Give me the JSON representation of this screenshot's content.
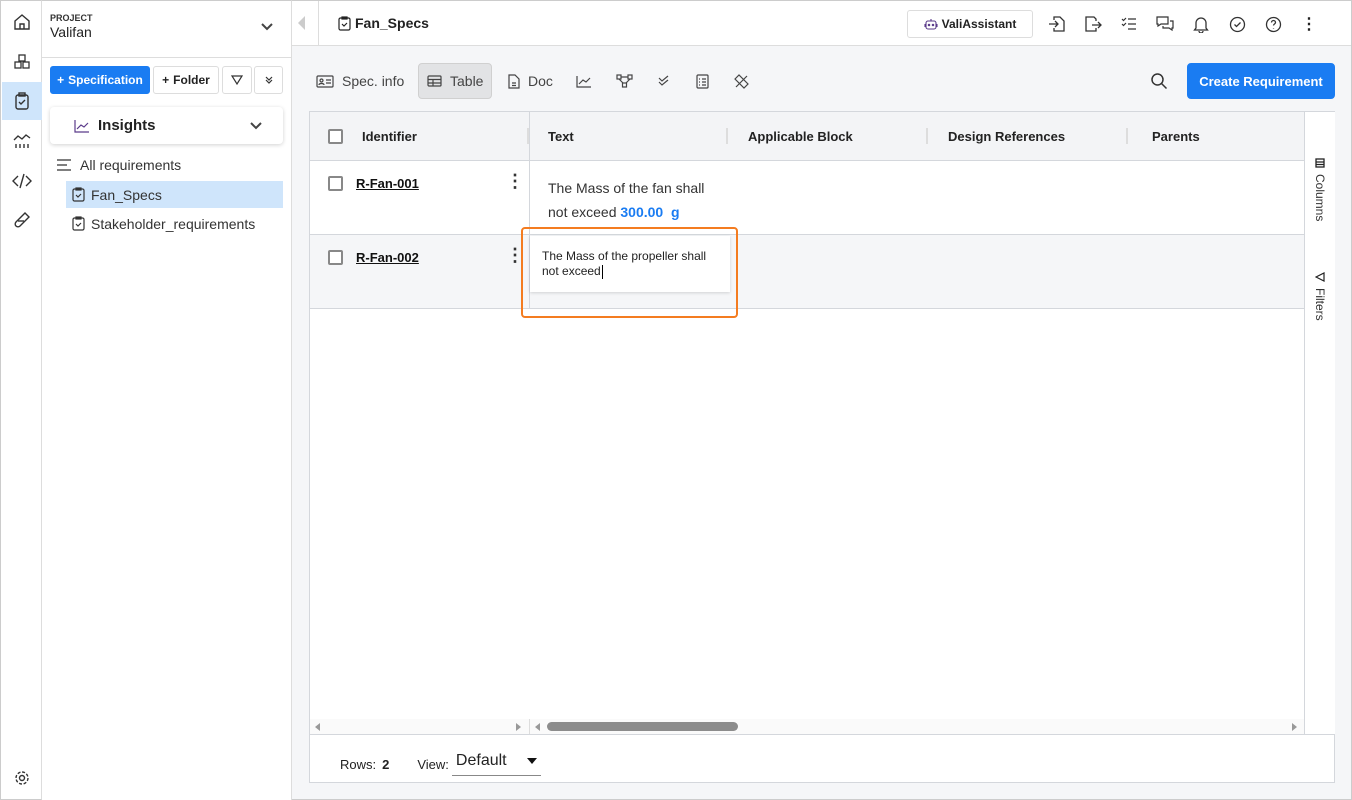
{
  "project": {
    "label": "PROJECT",
    "name": "Valifan"
  },
  "sidebar": {
    "add_spec": "Specification",
    "add_folder": "Folder",
    "insights": "Insights",
    "all_requirements": "All requirements",
    "specs": [
      "Fan_Specs",
      "Stakeholder_requirements"
    ]
  },
  "header": {
    "title": "Fan_Specs",
    "assistant": "ValiAssistant"
  },
  "toolbar": {
    "spec_info": "Spec. info",
    "table": "Table",
    "doc": "Doc",
    "create": "Create Requirement"
  },
  "table": {
    "columns": [
      "Identifier",
      "Text",
      "Applicable Block",
      "Design References",
      "Parents"
    ],
    "rows": [
      {
        "id": "R-Fan-001",
        "text": "The Mass of the fan shall not exceed",
        "value": "300.00",
        "unit": "g"
      },
      {
        "id": "R-Fan-002",
        "text_editing": "The Mass of the propeller shall not exceed"
      }
    ]
  },
  "sidepanel": {
    "columns": "Columns",
    "filters": "Filters"
  },
  "footer": {
    "rows_label": "Rows:",
    "rows_count": "2",
    "view_label": "View:",
    "view_value": "Default"
  },
  "colors": {
    "accent": "#1a7cf2",
    "highlight": "#f47c20"
  }
}
